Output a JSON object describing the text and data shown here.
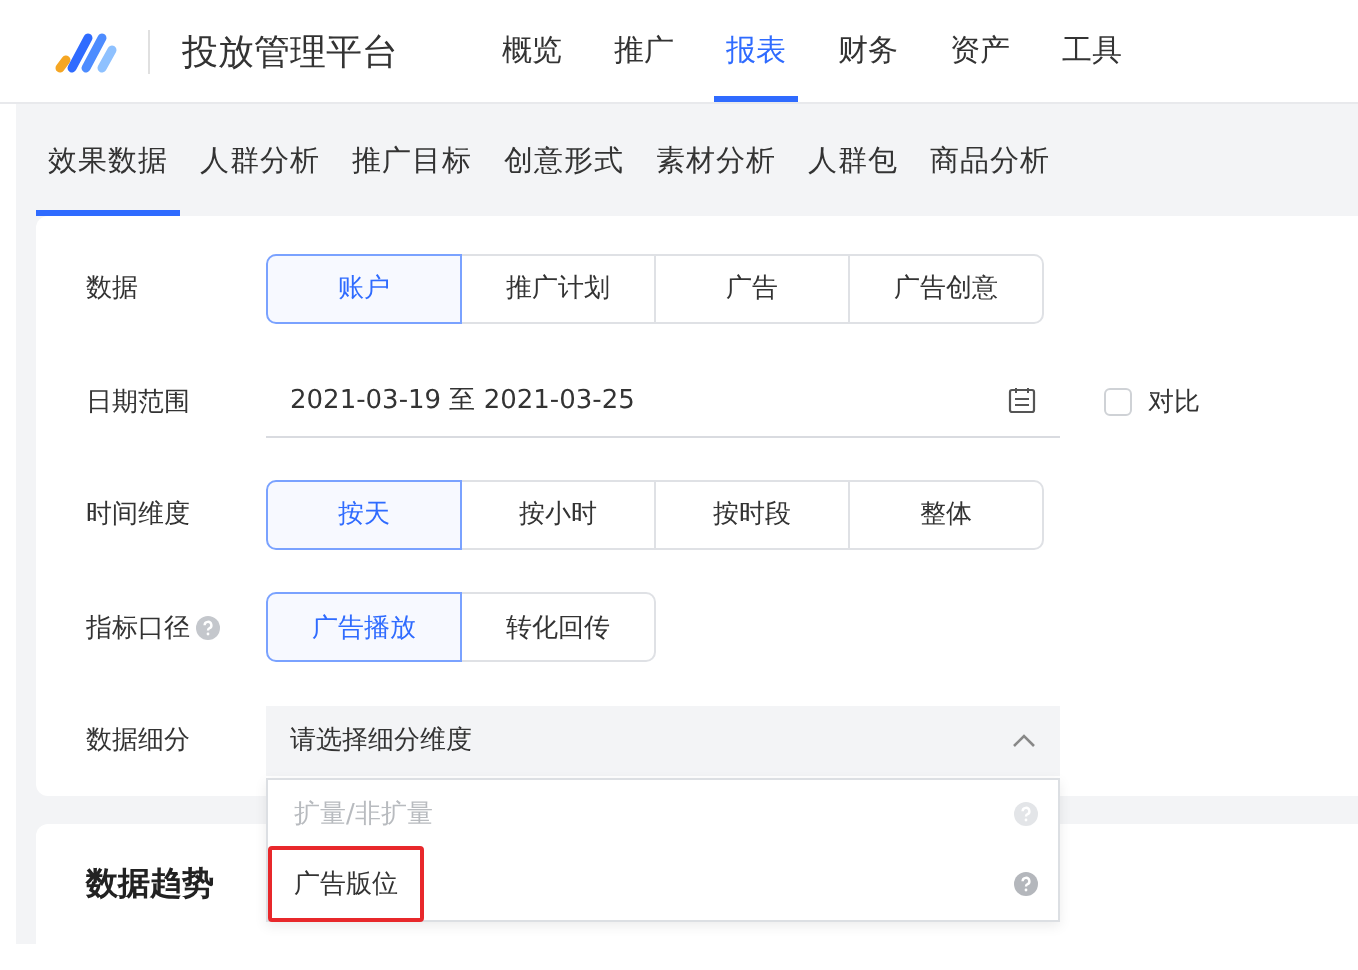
{
  "header": {
    "title": "投放管理平台",
    "nav": [
      {
        "label": "概览",
        "selected": false
      },
      {
        "label": "推广",
        "selected": false
      },
      {
        "label": "报表",
        "selected": true
      },
      {
        "label": "财务",
        "selected": false
      },
      {
        "label": "资产",
        "selected": false
      },
      {
        "label": "工具",
        "selected": false
      }
    ]
  },
  "subtabs": [
    {
      "label": "效果数据",
      "selected": true
    },
    {
      "label": "人群分析",
      "selected": false
    },
    {
      "label": "推广目标",
      "selected": false
    },
    {
      "label": "创意形式",
      "selected": false
    },
    {
      "label": "素材分析",
      "selected": false
    },
    {
      "label": "人群包",
      "selected": false
    },
    {
      "label": "商品分析",
      "selected": false
    }
  ],
  "filters": [
    {
      "kind": "segmented",
      "label": "数据",
      "options": [
        {
          "label": "账户",
          "selected": true
        },
        {
          "label": "推广计划",
          "selected": false
        },
        {
          "label": "广告",
          "selected": false
        },
        {
          "label": "广告创意",
          "selected": false
        }
      ]
    },
    {
      "kind": "date",
      "label": "日期范围",
      "value": "2021-03-19 至 2021-03-25",
      "compare": {
        "label": "对比",
        "checked": false
      }
    },
    {
      "kind": "segmented",
      "label": "时间维度",
      "options": [
        {
          "label": "按天",
          "selected": true
        },
        {
          "label": "按小时",
          "selected": false
        },
        {
          "label": "按时段",
          "selected": false
        },
        {
          "label": "整体",
          "selected": false
        }
      ]
    },
    {
      "kind": "segmented",
      "label": "指标口径",
      "help": true,
      "options": [
        {
          "label": "广告播放",
          "selected": true
        },
        {
          "label": "转化回传",
          "selected": false
        }
      ]
    },
    {
      "kind": "select",
      "label": "数据细分",
      "placeholder": "请选择细分维度",
      "expanded": true,
      "menu": [
        {
          "label": "扩量/非扩量",
          "disabled": true,
          "highlighted": false
        },
        {
          "label": "广告版位",
          "disabled": false,
          "highlighted": true
        }
      ]
    }
  ],
  "trend": {
    "title": "数据趋势"
  }
}
